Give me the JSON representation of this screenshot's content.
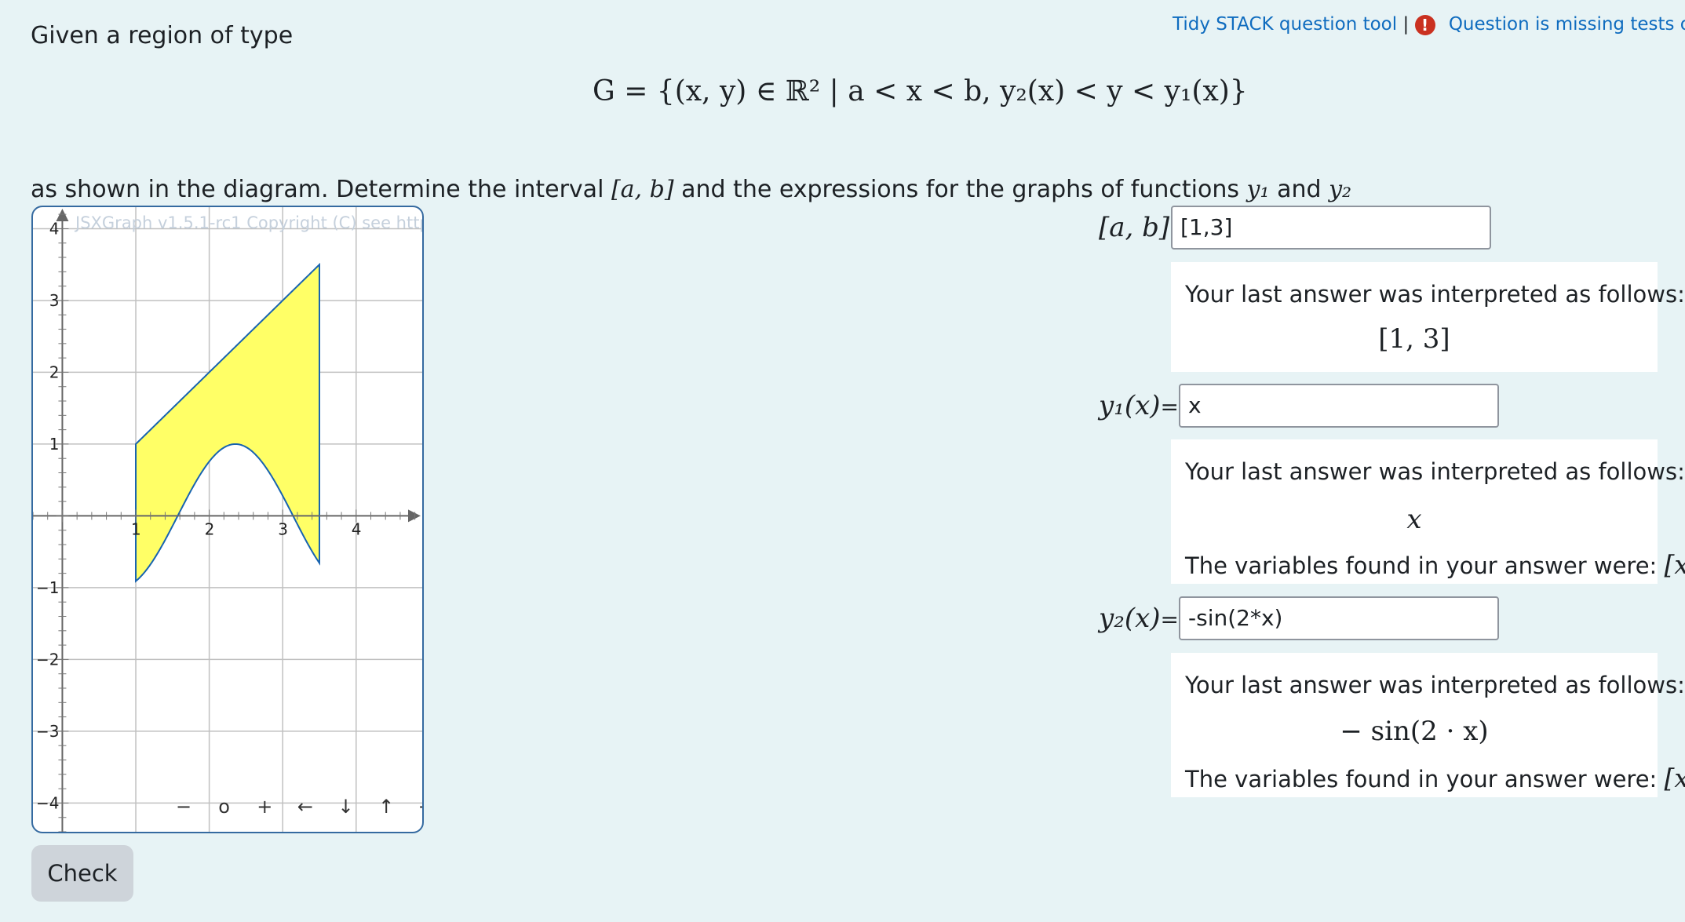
{
  "intro_text": "Given a region of type",
  "top_links": {
    "tidy_tool": "Tidy STACK question tool",
    "separator": "|",
    "alert_symbol": "!",
    "missing_tests": "Question is missing tests or va"
  },
  "region_formula": "G = {(x, y) ∈ ℝ² | a < x < b, y₂(x) < y < y₁(x)}",
  "instruction": {
    "before": "as shown in the diagram. Determine the interval",
    "interval": "[a, b]",
    "middle": "and the expressions for the graphs of functions",
    "y1": "y₁",
    "and": "and",
    "y2": "y₂"
  },
  "graph": {
    "copyright": "JSXGraph v1.5.1-rc1 Copyright (C) see http",
    "x_ticks": [
      "1",
      "2",
      "3",
      "4"
    ],
    "y_ticks": [
      "4",
      "3",
      "2",
      "1",
      "−1",
      "−2",
      "−3",
      "−4"
    ],
    "nav": {
      "zoom_out": "−",
      "reset": "o",
      "zoom_in": "+",
      "left": "←",
      "down": "↓",
      "up": "↑",
      "right": "→"
    },
    "x_range": [
      -0.4,
      4.9
    ],
    "y_range": [
      -4.4,
      4.3
    ],
    "region": {
      "a": 1,
      "b": 3.5,
      "upper": "x",
      "lower": "-sin(2*x)"
    },
    "fill_color": "#ffff66",
    "stroke_color": "#1763b0"
  },
  "answers": [
    {
      "label": "[a, b]",
      "equals": "=",
      "value": "[1,3]",
      "feedback_intro": "Your last answer was interpreted as follows:",
      "interpreted": "[1, 3]",
      "variables_text": "",
      "variables": ""
    },
    {
      "label": "y₁(x)",
      "equals": "=",
      "value": "x",
      "feedback_intro": "Your last answer was interpreted as follows:",
      "interpreted": "x",
      "variables_text": "The variables found in your answer were:",
      "variables": "[x]"
    },
    {
      "label": "y₂(x)",
      "equals": "=",
      "value": "-sin(2*x)",
      "feedback_intro": "Your last answer was interpreted as follows:",
      "interpreted": "− sin(2 · x)",
      "variables_text": "The variables found in your answer were:",
      "variables": "[x]"
    }
  ],
  "check_button": "Check"
}
